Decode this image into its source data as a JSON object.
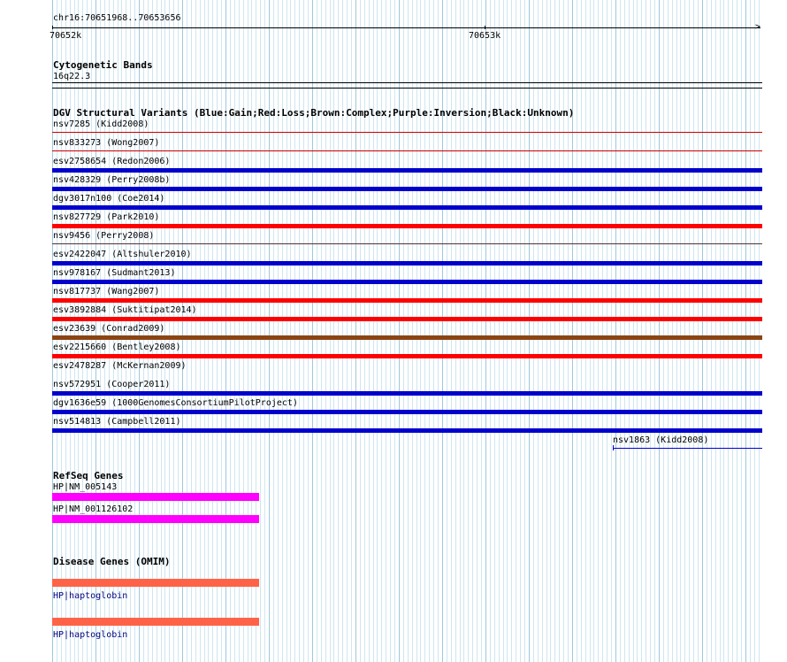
{
  "ruler": {
    "coords": "chr16:70651968..70653656",
    "ticks": [
      "70652k",
      "70653k"
    ]
  },
  "cytoband": {
    "title": "Cytogenetic Bands",
    "label": "16q22.3"
  },
  "dgv": {
    "title": "DGV Structural Variants (Blue:Gain;Red:Loss;Brown:Complex;Purple:Inversion;Black:Unknown)",
    "colors": {
      "gain": "#0000cc",
      "loss": "#ff0000",
      "complex": "#8b4513"
    },
    "items": [
      {
        "label": "nsv7285 (Kidd2008)",
        "type": "loss-thin"
      },
      {
        "label": "nsv833273 (Wong2007)",
        "type": "loss-thin"
      },
      {
        "label": "esv2758654 (Redon2006)",
        "type": "gain"
      },
      {
        "label": "nsv428329 (Perry2008b)",
        "type": "gain"
      },
      {
        "label": "dgv3017n100 (Coe2014)",
        "type": "gain"
      },
      {
        "label": "nsv827729 (Park2010)",
        "type": "loss"
      },
      {
        "label": "nsv9456 (Perry2008)",
        "type": "thin-black"
      },
      {
        "label": "esv2422047 (Altshuler2010)",
        "type": "gain"
      },
      {
        "label": "nsv978167 (Sudmant2013)",
        "type": "gain"
      },
      {
        "label": "nsv817737 (Wang2007)",
        "type": "loss"
      },
      {
        "label": "esv3892884 (Suktitipat2014)",
        "type": "loss"
      },
      {
        "label": "esv23639 (Conrad2009)",
        "type": "complex"
      },
      {
        "label": "esv2215660 (Bentley2008)",
        "type": "loss"
      },
      {
        "label": "esv2478287 (McKernan2009)",
        "type": "none"
      },
      {
        "label": "nsv572951 (Cooper2011)",
        "type": "gain"
      },
      {
        "label": "dgv1636e59 (1000GenomesConsortiumPilotProject)",
        "type": "gain"
      },
      {
        "label": "nsv514813 (Campbell2011)",
        "type": "gain"
      }
    ],
    "extra": {
      "label": "nsv1863 (Kidd2008)"
    }
  },
  "refseq": {
    "title": "RefSeq Genes",
    "color": "#ff00ff",
    "items": [
      {
        "label": "HP|NM_005143"
      },
      {
        "label": "HP|NM_001126102"
      }
    ]
  },
  "omim": {
    "title": "Disease Genes (OMIM)",
    "color": "#ff6347",
    "items": [
      {
        "label": "HP|haptoglobin"
      },
      {
        "label": "HP|haptoglobin"
      }
    ]
  }
}
